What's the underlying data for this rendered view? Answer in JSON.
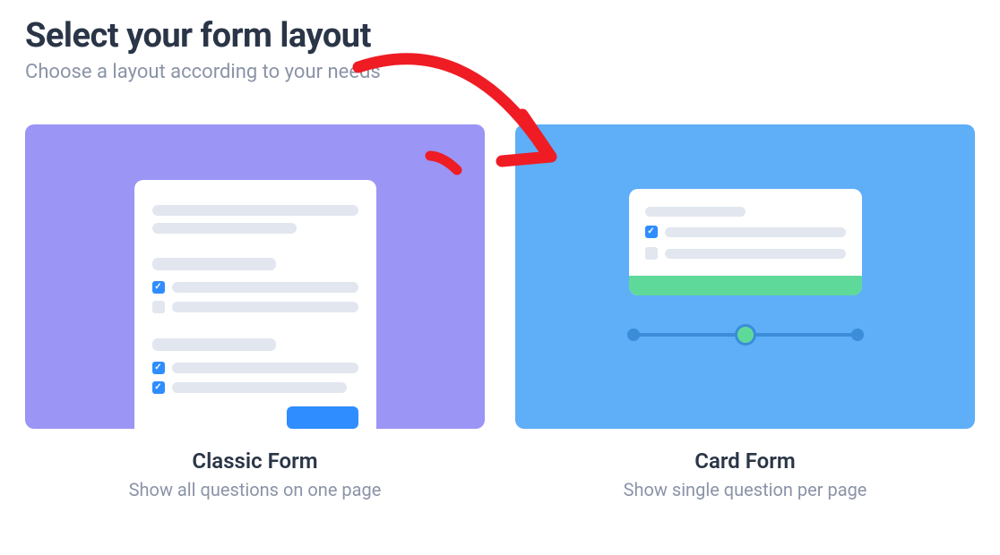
{
  "header": {
    "title": "Select your form layout",
    "subtitle": "Choose a layout according to your needs"
  },
  "options": {
    "classic": {
      "title": "Classic Form",
      "desc": "Show all questions on one page"
    },
    "card": {
      "title": "Card Form",
      "desc": "Show single question per page"
    }
  }
}
